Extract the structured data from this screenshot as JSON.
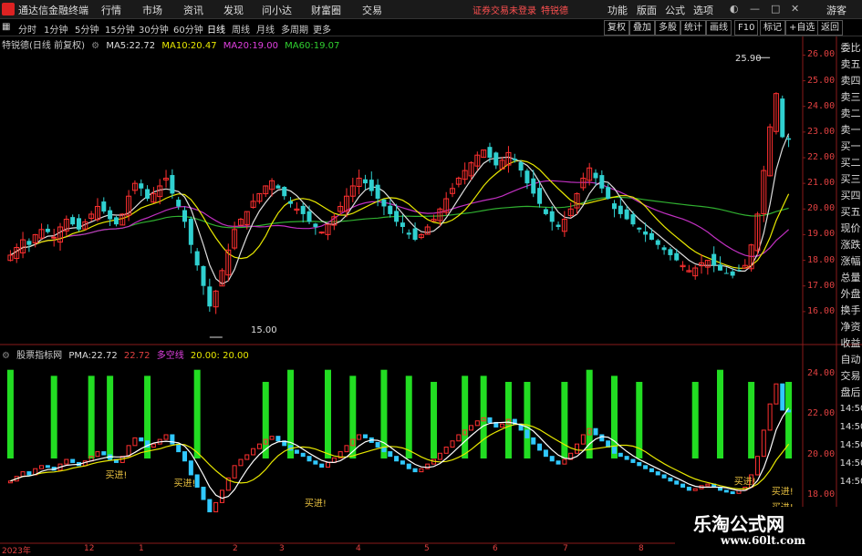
{
  "menubar": {
    "app_name": "通达信金融终端",
    "items": [
      "行情",
      "市场",
      "资讯",
      "发现",
      "问小达",
      "财富圈",
      "交易"
    ],
    "notice": "证券交易未登录",
    "notice_name": "特锐德",
    "right_items": [
      "功能",
      "版面",
      "公式",
      "选项"
    ],
    "guest": "游客"
  },
  "toolbar": {
    "periods": [
      "分时",
      "1分钟",
      "5分钟",
      "15分钟",
      "30分钟",
      "60分钟",
      "日线",
      "周线",
      "月线",
      "多周期",
      "更多"
    ],
    "active_period": "日线",
    "buttons": [
      "复权",
      "叠加",
      "多股",
      "统计",
      "画线",
      "F10",
      "标记",
      "+自选",
      "返回"
    ]
  },
  "main_chart": {
    "stock_name": "特锐德(日线 前复权)",
    "ma": [
      {
        "label": "MA5:",
        "value": "22.72",
        "color": "#dddddd"
      },
      {
        "label": "MA10:",
        "value": "20.47",
        "color": "#e8e800"
      },
      {
        "label": "MA20:",
        "value": "19.00",
        "color": "#e040e0"
      },
      {
        "label": "MA60:",
        "value": "19.07",
        "color": "#30d030"
      }
    ],
    "high_label": "25.90",
    "low_label": "15.00",
    "yticks": [
      "26.00",
      "25.00",
      "24.00",
      "23.00",
      "22.00",
      "21.00",
      "20.00",
      "19.00",
      "18.00",
      "17.00",
      "16.00"
    ]
  },
  "sub_chart": {
    "indicator_name": "股票指标网",
    "pma_label": "PMA:",
    "pma_value": "22.72",
    "val2": "22.72",
    "duokong_label": "多空线",
    "val3": "20.00",
    "val4": ": 20.00",
    "yticks": [
      "24.00",
      "22.00",
      "20.00",
      "18.00"
    ],
    "buy_label": "买进!"
  },
  "right_panel": {
    "labels": [
      "委比",
      "卖五",
      "卖四",
      "卖三",
      "卖二",
      "卖一",
      "买一",
      "买二",
      "买三",
      "买四",
      "买五",
      "现价",
      "涨跌",
      "涨幅",
      "总量",
      "外盘",
      "换手",
      "净资",
      "收益"
    ],
    "labels2": [
      "自动",
      "交易",
      "盘后"
    ],
    "times": [
      "14:50",
      "14:50",
      "14:50",
      "14:50",
      "14:50"
    ]
  },
  "date_axis": [
    "2023年",
    "12",
    "1",
    "2",
    "3",
    "4",
    "5",
    "6",
    "7",
    "8"
  ],
  "watermark": {
    "title": "乐淘公式网",
    "url": "www.60lt.com"
  },
  "chart_data": [
    {
      "type": "candlestick",
      "title": "特锐德(日线 前复权)",
      "ylim": [
        15,
        26.3
      ],
      "y_ticks": [
        16,
        17,
        18,
        19,
        20,
        21,
        22,
        23,
        24,
        25,
        26
      ],
      "close": [
        18.2,
        18.5,
        18.8,
        18.6,
        19.0,
        19.2,
        19.1,
        18.9,
        19.3,
        19.6,
        19.4,
        19.2,
        19.5,
        19.8,
        20.1,
        19.9,
        19.6,
        19.4,
        19.8,
        20.5,
        21.0,
        20.8,
        20.4,
        20.6,
        20.9,
        21.2,
        20.6,
        20.1,
        19.5,
        18.6,
        17.8,
        17.0,
        16.2,
        16.8,
        17.6,
        18.4,
        19.2,
        19.6,
        19.9,
        20.3,
        20.6,
        20.9,
        21.1,
        20.8,
        20.5,
        20.2,
        20.0,
        19.8,
        19.5,
        19.3,
        19.1,
        19.4,
        19.7,
        20.1,
        20.5,
        20.9,
        21.2,
        21.0,
        20.7,
        20.4,
        20.1,
        19.8,
        19.5,
        19.3,
        19.0,
        18.8,
        19.0,
        19.3,
        19.6,
        20.0,
        20.4,
        20.8,
        21.2,
        21.5,
        21.8,
        22.1,
        22.3,
        22.0,
        21.7,
        21.9,
        22.2,
        21.9,
        21.5,
        21.0,
        20.6,
        20.2,
        19.8,
        19.5,
        19.3,
        19.6,
        20.0,
        20.6,
        21.2,
        21.6,
        21.2,
        20.8,
        20.4,
        20.0,
        19.8,
        19.6,
        19.4,
        19.2,
        19.0,
        18.8,
        18.6,
        18.4,
        18.2,
        18.0,
        17.8,
        17.6,
        17.7,
        17.9,
        18.0,
        17.8,
        17.6,
        17.5,
        17.4,
        17.6,
        17.8,
        18.6,
        19.8,
        21.5,
        23.2,
        24.5,
        22.8,
        22.7
      ],
      "ma5_last": 22.72,
      "ma10_last": 20.47,
      "ma20_last": 19.0,
      "ma60_last": 19.07,
      "high": 25.9,
      "low": 15.0
    },
    {
      "type": "bar",
      "title": "股票指标网",
      "ylim": [
        16.5,
        25
      ],
      "y_ticks": [
        18,
        20,
        22,
        24
      ],
      "pma_last": 22.72,
      "duokong_last": 20.0
    }
  ]
}
